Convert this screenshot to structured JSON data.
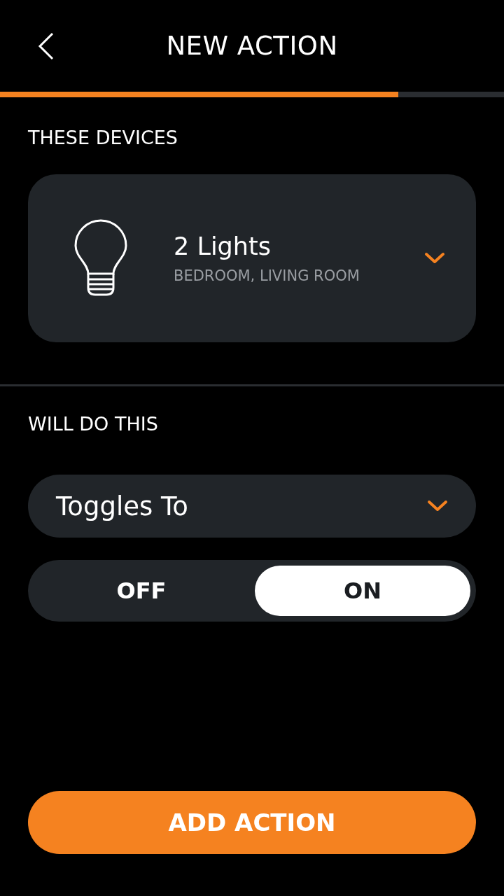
{
  "header": {
    "title": "NEW ACTION"
  },
  "progress": {
    "level": 0.79
  },
  "devices_section": {
    "label": "THESE DEVICES",
    "device": {
      "name": "2 Lights",
      "rooms": "BEDROOM, LIVING ROOM"
    }
  },
  "action_section": {
    "label": "WILL DO THIS",
    "dropdown": {
      "value": "Toggles To"
    },
    "toggle": [
      {
        "label": "OFF",
        "selected": false
      },
      {
        "label": "ON",
        "selected": true
      }
    ]
  },
  "button": {
    "label": "ADD ACTION"
  }
}
